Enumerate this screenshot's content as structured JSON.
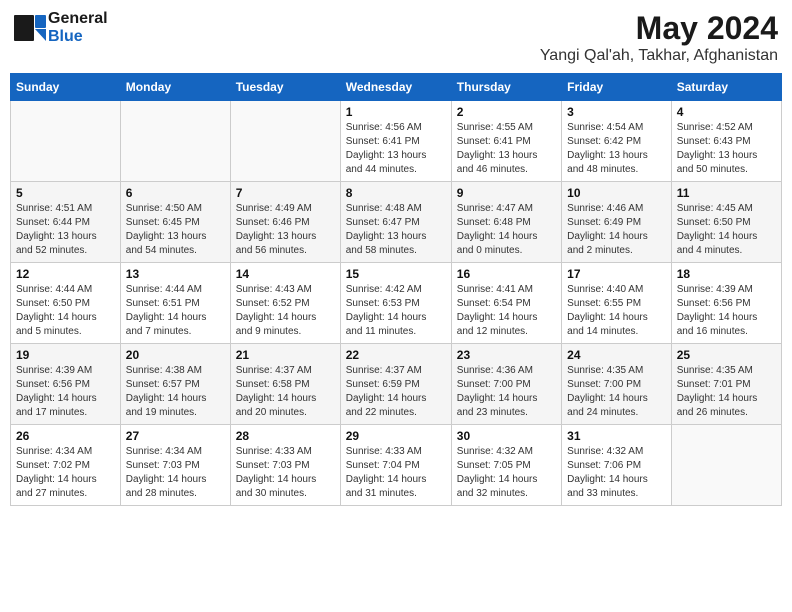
{
  "header": {
    "logo_general": "General",
    "logo_blue": "Blue",
    "main_title": "May 2024",
    "subtitle": "Yangi Qal'ah, Takhar, Afghanistan"
  },
  "calendar": {
    "days_of_week": [
      "Sunday",
      "Monday",
      "Tuesday",
      "Wednesday",
      "Thursday",
      "Friday",
      "Saturday"
    ],
    "weeks": [
      [
        {
          "day": "",
          "info": ""
        },
        {
          "day": "",
          "info": ""
        },
        {
          "day": "",
          "info": ""
        },
        {
          "day": "1",
          "info": "Sunrise: 4:56 AM\nSunset: 6:41 PM\nDaylight: 13 hours\nand 44 minutes."
        },
        {
          "day": "2",
          "info": "Sunrise: 4:55 AM\nSunset: 6:41 PM\nDaylight: 13 hours\nand 46 minutes."
        },
        {
          "day": "3",
          "info": "Sunrise: 4:54 AM\nSunset: 6:42 PM\nDaylight: 13 hours\nand 48 minutes."
        },
        {
          "day": "4",
          "info": "Sunrise: 4:52 AM\nSunset: 6:43 PM\nDaylight: 13 hours\nand 50 minutes."
        }
      ],
      [
        {
          "day": "5",
          "info": "Sunrise: 4:51 AM\nSunset: 6:44 PM\nDaylight: 13 hours\nand 52 minutes."
        },
        {
          "day": "6",
          "info": "Sunrise: 4:50 AM\nSunset: 6:45 PM\nDaylight: 13 hours\nand 54 minutes."
        },
        {
          "day": "7",
          "info": "Sunrise: 4:49 AM\nSunset: 6:46 PM\nDaylight: 13 hours\nand 56 minutes."
        },
        {
          "day": "8",
          "info": "Sunrise: 4:48 AM\nSunset: 6:47 PM\nDaylight: 13 hours\nand 58 minutes."
        },
        {
          "day": "9",
          "info": "Sunrise: 4:47 AM\nSunset: 6:48 PM\nDaylight: 14 hours\nand 0 minutes."
        },
        {
          "day": "10",
          "info": "Sunrise: 4:46 AM\nSunset: 6:49 PM\nDaylight: 14 hours\nand 2 minutes."
        },
        {
          "day": "11",
          "info": "Sunrise: 4:45 AM\nSunset: 6:50 PM\nDaylight: 14 hours\nand 4 minutes."
        }
      ],
      [
        {
          "day": "12",
          "info": "Sunrise: 4:44 AM\nSunset: 6:50 PM\nDaylight: 14 hours\nand 5 minutes."
        },
        {
          "day": "13",
          "info": "Sunrise: 4:44 AM\nSunset: 6:51 PM\nDaylight: 14 hours\nand 7 minutes."
        },
        {
          "day": "14",
          "info": "Sunrise: 4:43 AM\nSunset: 6:52 PM\nDaylight: 14 hours\nand 9 minutes."
        },
        {
          "day": "15",
          "info": "Sunrise: 4:42 AM\nSunset: 6:53 PM\nDaylight: 14 hours\nand 11 minutes."
        },
        {
          "day": "16",
          "info": "Sunrise: 4:41 AM\nSunset: 6:54 PM\nDaylight: 14 hours\nand 12 minutes."
        },
        {
          "day": "17",
          "info": "Sunrise: 4:40 AM\nSunset: 6:55 PM\nDaylight: 14 hours\nand 14 minutes."
        },
        {
          "day": "18",
          "info": "Sunrise: 4:39 AM\nSunset: 6:56 PM\nDaylight: 14 hours\nand 16 minutes."
        }
      ],
      [
        {
          "day": "19",
          "info": "Sunrise: 4:39 AM\nSunset: 6:56 PM\nDaylight: 14 hours\nand 17 minutes."
        },
        {
          "day": "20",
          "info": "Sunrise: 4:38 AM\nSunset: 6:57 PM\nDaylight: 14 hours\nand 19 minutes."
        },
        {
          "day": "21",
          "info": "Sunrise: 4:37 AM\nSunset: 6:58 PM\nDaylight: 14 hours\nand 20 minutes."
        },
        {
          "day": "22",
          "info": "Sunrise: 4:37 AM\nSunset: 6:59 PM\nDaylight: 14 hours\nand 22 minutes."
        },
        {
          "day": "23",
          "info": "Sunrise: 4:36 AM\nSunset: 7:00 PM\nDaylight: 14 hours\nand 23 minutes."
        },
        {
          "day": "24",
          "info": "Sunrise: 4:35 AM\nSunset: 7:00 PM\nDaylight: 14 hours\nand 24 minutes."
        },
        {
          "day": "25",
          "info": "Sunrise: 4:35 AM\nSunset: 7:01 PM\nDaylight: 14 hours\nand 26 minutes."
        }
      ],
      [
        {
          "day": "26",
          "info": "Sunrise: 4:34 AM\nSunset: 7:02 PM\nDaylight: 14 hours\nand 27 minutes."
        },
        {
          "day": "27",
          "info": "Sunrise: 4:34 AM\nSunset: 7:03 PM\nDaylight: 14 hours\nand 28 minutes."
        },
        {
          "day": "28",
          "info": "Sunrise: 4:33 AM\nSunset: 7:03 PM\nDaylight: 14 hours\nand 30 minutes."
        },
        {
          "day": "29",
          "info": "Sunrise: 4:33 AM\nSunset: 7:04 PM\nDaylight: 14 hours\nand 31 minutes."
        },
        {
          "day": "30",
          "info": "Sunrise: 4:32 AM\nSunset: 7:05 PM\nDaylight: 14 hours\nand 32 minutes."
        },
        {
          "day": "31",
          "info": "Sunrise: 4:32 AM\nSunset: 7:06 PM\nDaylight: 14 hours\nand 33 minutes."
        },
        {
          "day": "",
          "info": ""
        }
      ]
    ]
  }
}
